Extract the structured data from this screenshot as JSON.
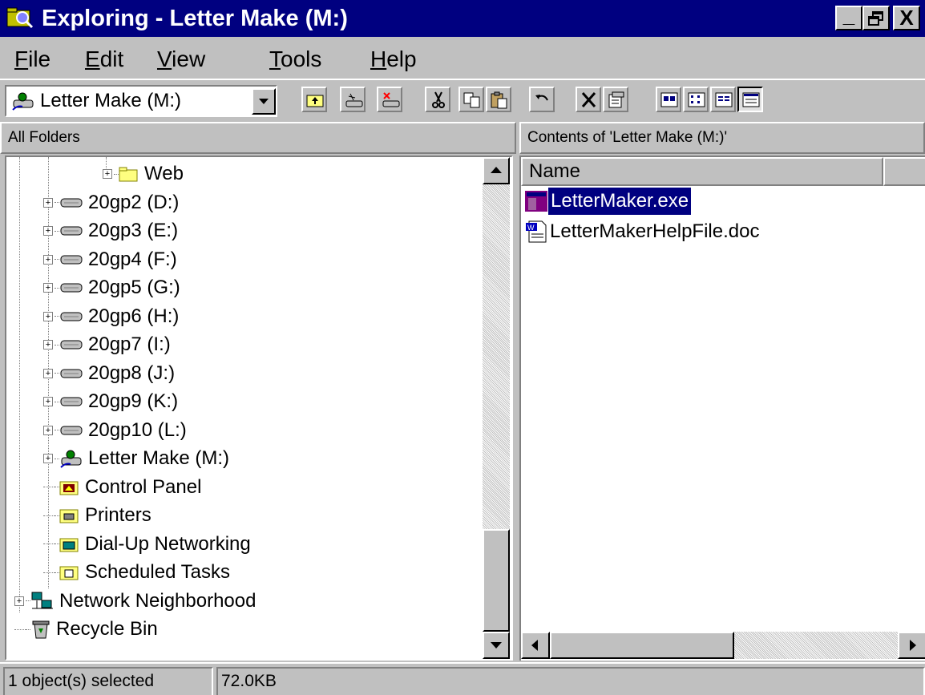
{
  "window": {
    "title": "Exploring - Letter Make (M:)",
    "minimize_label": "_",
    "close_label": "X"
  },
  "menu": [
    {
      "label": "File",
      "key": "F",
      "rest": "ile"
    },
    {
      "label": "Edit",
      "key": "E",
      "rest": "dit"
    },
    {
      "label": "View",
      "key": "V",
      "rest": "iew"
    },
    {
      "label": "Tools",
      "key": "T",
      "rest": "ools"
    },
    {
      "label": "Help",
      "key": "H",
      "rest": "elp"
    }
  ],
  "toolbar": {
    "address_value": "Letter Make (M:)",
    "buttons": [
      "up-one-level",
      "map-network-drive",
      "disconnect-network-drive",
      "cut",
      "copy",
      "paste",
      "undo",
      "delete",
      "properties",
      "large-icons",
      "small-icons",
      "list",
      "details"
    ]
  },
  "panes": {
    "left_header": "All Folders",
    "right_header": "Contents of 'Letter Make (M:)'"
  },
  "tree": [
    {
      "label": "Web",
      "icon": "folder-icon",
      "expander": "+"
    },
    {
      "label": "20gp2 (D:)",
      "icon": "network-drive-icon",
      "expander": "+"
    },
    {
      "label": "20gp3 (E:)",
      "icon": "network-drive-icon",
      "expander": "+"
    },
    {
      "label": "20gp4 (F:)",
      "icon": "network-drive-icon",
      "expander": "+"
    },
    {
      "label": "20gp5 (G:)",
      "icon": "network-drive-icon",
      "expander": "+"
    },
    {
      "label": "20gp6 (H:)",
      "icon": "network-drive-icon",
      "expander": "+"
    },
    {
      "label": "20gp7 (I:)",
      "icon": "network-drive-icon",
      "expander": "+"
    },
    {
      "label": "20gp8 (J:)",
      "icon": "network-drive-icon",
      "expander": "+"
    },
    {
      "label": "20gp9 (K:)",
      "icon": "network-drive-icon",
      "expander": "+"
    },
    {
      "label": "20gp10 (L:)",
      "icon": "network-drive-icon",
      "expander": "+"
    },
    {
      "label": "Letter Make (M:)",
      "icon": "shared-drive-icon",
      "expander": "+"
    },
    {
      "label": "Control Panel",
      "icon": "control-panel-icon",
      "expander": ""
    },
    {
      "label": "Printers",
      "icon": "printers-icon",
      "expander": ""
    },
    {
      "label": "Dial-Up Networking",
      "icon": "dialup-icon",
      "expander": ""
    },
    {
      "label": "Scheduled Tasks",
      "icon": "scheduled-tasks-icon",
      "expander": ""
    },
    {
      "label": "Network Neighborhood",
      "icon": "network-neighborhood-icon",
      "expander": "+"
    },
    {
      "label": "Recycle Bin",
      "icon": "recycle-bin-icon",
      "expander": ""
    }
  ],
  "contents": {
    "columns": [
      "Name"
    ],
    "files": [
      {
        "name": "LetterMaker.exe",
        "icon": "exe-icon",
        "selected": true
      },
      {
        "name": "LetterMakerHelpFile.doc",
        "icon": "doc-icon",
        "selected": false
      }
    ]
  },
  "status": {
    "selection": "1 object(s) selected",
    "size": "72.0KB"
  },
  "colors": {
    "titlebar": "#000080",
    "face": "#c0c0c0",
    "selection": "#000080"
  }
}
